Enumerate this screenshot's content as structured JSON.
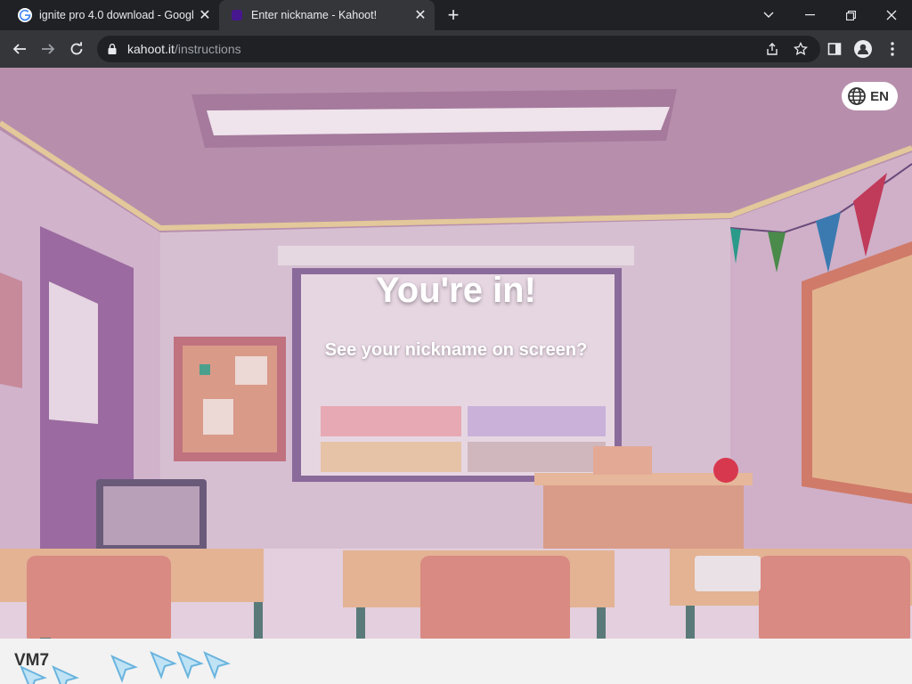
{
  "browser": {
    "tabs": [
      {
        "title": "ignite pro 4.0 download - Googl",
        "favicon": "google-g-icon",
        "active": false
      },
      {
        "title": "Enter nickname - Kahoot!",
        "favicon": "kahoot-icon",
        "active": true
      }
    ],
    "url_host": "kahoot.it",
    "url_path": "/instructions"
  },
  "page": {
    "language": "EN",
    "headline": "You're in!",
    "subheadline": "See your nickname on screen?",
    "nickname": "VM7",
    "accent_colors": {
      "brand_purple": "#46178f",
      "overlay": "#c8a9c4",
      "bar": "#f2f2f2"
    }
  }
}
